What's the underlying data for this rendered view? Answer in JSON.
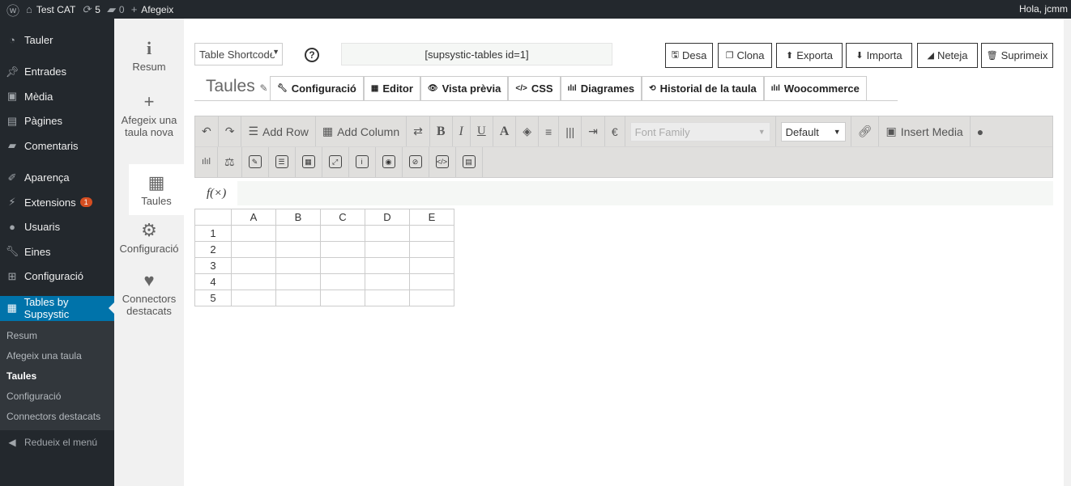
{
  "adminbar": {
    "site": "Test CAT",
    "updates": "5",
    "comments": "0",
    "add": "Afegeix",
    "greeting": "Hola, jcmm"
  },
  "sidebar": {
    "items": [
      {
        "label": "Tauler",
        "icon": "dashboard-icon"
      },
      {
        "label": "Entrades",
        "icon": "pin-icon"
      },
      {
        "label": "Mèdia",
        "icon": "media-icon"
      },
      {
        "label": "Pàgines",
        "icon": "page-icon"
      },
      {
        "label": "Comentaris",
        "icon": "comment-icon"
      },
      {
        "label": "Aparença",
        "icon": "brush-icon"
      },
      {
        "label": "Extensions",
        "icon": "plugin-icon",
        "badge": "1"
      },
      {
        "label": "Usuaris",
        "icon": "user-icon"
      },
      {
        "label": "Eines",
        "icon": "wrench-icon"
      },
      {
        "label": "Configuració",
        "icon": "settings-icon"
      },
      {
        "label": "Tables by Supsystic",
        "icon": "table-icon"
      }
    ],
    "submenu": [
      "Resum",
      "Afegeix una taula",
      "Taules",
      "Configuració",
      "Connectors destacats"
    ],
    "collapse": "Redueix el menú",
    "accent": "#0073aa"
  },
  "pluginnav": [
    {
      "label": "Resum",
      "icon": "info-icon"
    },
    {
      "label": "Afegeix una taula nova",
      "icon": "plus-icon"
    },
    {
      "label": "Taules",
      "icon": "table-icon"
    },
    {
      "label": "Configuració",
      "icon": "gear-icon"
    },
    {
      "label": "Connectors destacats",
      "icon": "heart-icon"
    }
  ],
  "header": {
    "shortcode_select": "Table Shortcode",
    "help": "?",
    "shortcode": "[supsystic-tables id=1]",
    "title": "Taules",
    "buttons": [
      "Desa",
      "Clona",
      "Exporta",
      "Importa",
      "Neteja",
      "Suprimeix"
    ],
    "tabs": [
      "Configuració",
      "Editor",
      "Vista prèvia",
      "CSS",
      "Diagrames",
      "Historial de la taula",
      "Woocommerce"
    ]
  },
  "toolbar": {
    "add_row": "Add Row",
    "add_column": "Add Column",
    "bold": "B",
    "italic": "I",
    "underline": "U",
    "color": "A",
    "currency": "€",
    "font_family": "Font Family",
    "font_size": "Default",
    "insert_media": "Insert Media"
  },
  "formula": {
    "label": "f(×)",
    "value": ""
  },
  "grid": {
    "columns": [
      "A",
      "B",
      "C",
      "D",
      "E"
    ],
    "rows": [
      "1",
      "2",
      "3",
      "4",
      "5"
    ]
  }
}
